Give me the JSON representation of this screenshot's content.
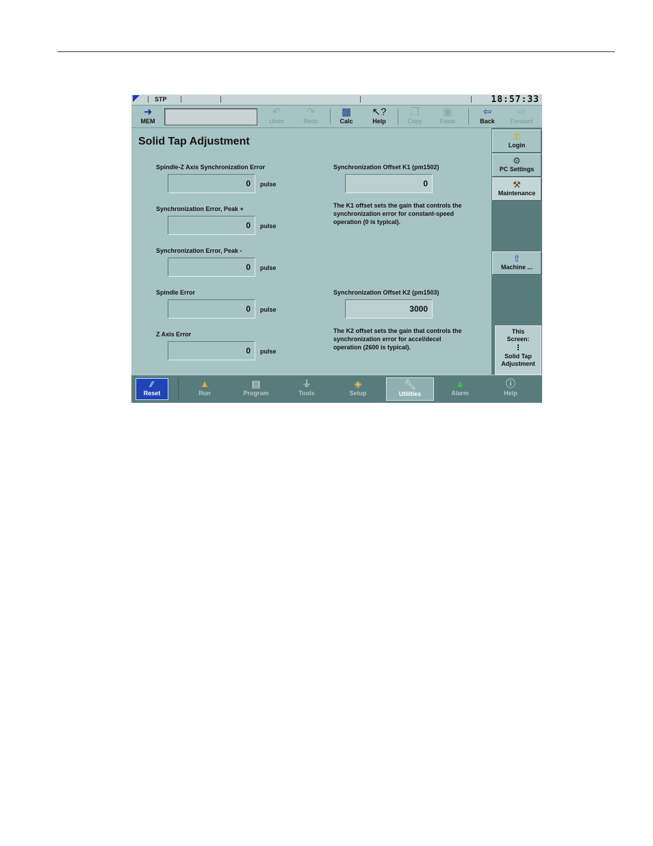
{
  "status": {
    "mode": "STP",
    "clock": "18:57:33"
  },
  "toolbar": {
    "mem_label": "MEM",
    "undo_label": "Undo",
    "redo_label": "Redo",
    "calc_label": "Calc",
    "help_label": "Help",
    "copy_label": "Copy",
    "paste_label": "Paste",
    "back_label": "Back",
    "forward_label": "Forward"
  },
  "page": {
    "title": "Solid Tap Adjustment"
  },
  "fields": [
    {
      "label": "Spindle-Z Axis Synchronization Error",
      "value": "0",
      "unit": "pulse"
    },
    {
      "label": "Synchronization Error, Peak +",
      "value": "0",
      "unit": "pulse"
    },
    {
      "label": "Synchronization Error, Peak -",
      "value": "0",
      "unit": "pulse"
    },
    {
      "label": "Spindle Error",
      "value": "0",
      "unit": "pulse"
    },
    {
      "label": "Z Axis Error",
      "value": "0",
      "unit": "pulse"
    }
  ],
  "offsets": [
    {
      "label": "Synchronization Offset K1 (pm1502)",
      "value": "0",
      "description": "The K1 offset sets the gain that controls the synchronization error for constant-speed operation (0 is typical)."
    },
    {
      "label": "Synchronization Offset K2 (pm1503)",
      "value": "3000",
      "description": "The K2 offset sets the gain that controls the synchronization error for accel/decel operation (2600 is typical)."
    }
  ],
  "side": {
    "login_label": "Login",
    "pc_settings_label": "PC Settings",
    "maintenance_label": "Maintenance",
    "machine_label": "Machine ...",
    "this_screen_line1": "This",
    "this_screen_line2": "Screen:",
    "this_screen_line3": "Solid Tap",
    "this_screen_line4": "Adjustment"
  },
  "nav": {
    "reset_label": "Reset",
    "items": [
      {
        "label": "Run"
      },
      {
        "label": "Program"
      },
      {
        "label": "Tools"
      },
      {
        "label": "Setup"
      },
      {
        "label": "Utilities"
      },
      {
        "label": "Alarm"
      },
      {
        "label": "Help"
      }
    ]
  },
  "colors": {
    "screen_bg": "#a7c4c4",
    "panel": "#587c7c",
    "reset": "#1f44b8"
  }
}
